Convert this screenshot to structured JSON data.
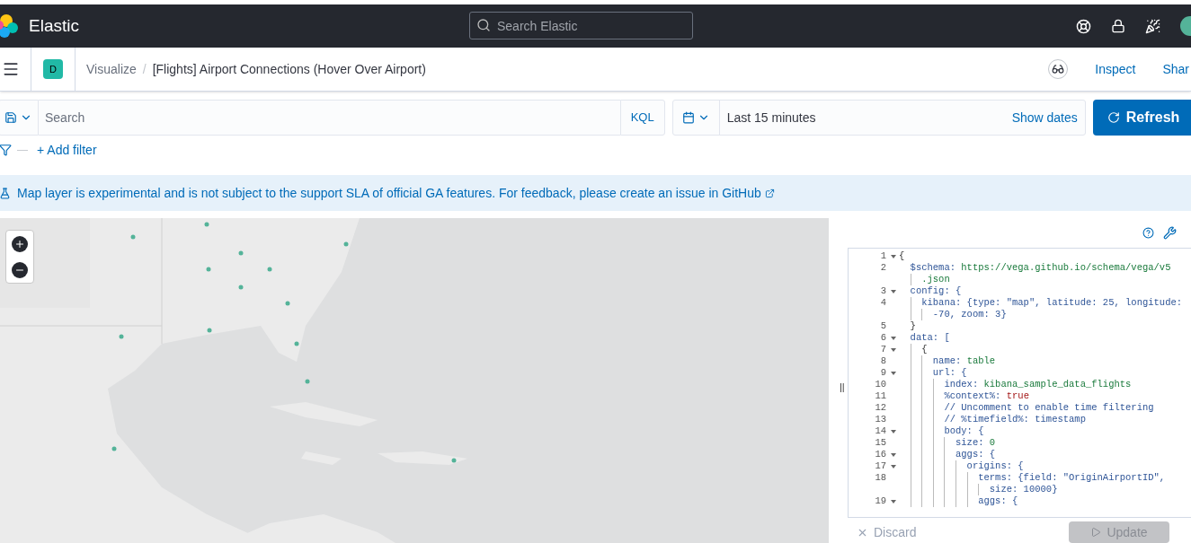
{
  "header": {
    "brand": "Elastic",
    "search_placeholder": "Search Elastic"
  },
  "breadcrumbs": {
    "space_badge": "D",
    "items": [
      {
        "label": "Visualize",
        "link": true
      },
      {
        "label": "[Flights] Airport Connections (Hover Over Airport)",
        "link": false
      }
    ],
    "separator": "/",
    "actions": [
      "Inspect",
      "Shar"
    ]
  },
  "query_bar": {
    "placeholder": "Search",
    "language": "KQL",
    "time_range": "Last 15 minutes",
    "show_dates": "Show dates",
    "refresh": "Refresh"
  },
  "filter_bar": {
    "separator": "—",
    "add_filter": "+ Add filter"
  },
  "callout": {
    "text": "Map layer is experimental and is not subject to the support SLA of official GA features. For feedback, please create an issue in GitHub"
  },
  "editor": {
    "handle": "||",
    "lines": [
      {
        "number": "1",
        "fold": true,
        "segments": [
          {
            "text": "{",
            "kind": "plain"
          }
        ]
      },
      {
        "number": "2",
        "fold": false,
        "segments": [
          {
            "text": "  $schema: ",
            "kind": "key"
          },
          {
            "text": "https://vega.github.io/schema/vega/v5",
            "kind": "str"
          }
        ],
        "continuation": [
          {
            "text": "    .json",
            "kind": "str"
          }
        ]
      },
      {
        "number": "3",
        "fold": true,
        "segments": [
          {
            "text": "  config: {",
            "kind": "key"
          }
        ]
      },
      {
        "number": "4",
        "fold": false,
        "segments": [
          {
            "text": "    kibana: {type: \"map\", latitude: 25, longitude:",
            "kind": "key"
          }
        ],
        "continuation": [
          {
            "text": "      -70, zoom: 3}",
            "kind": "key"
          }
        ]
      },
      {
        "number": "5",
        "fold": false,
        "segments": [
          {
            "text": "  }",
            "kind": "plain"
          }
        ]
      },
      {
        "number": "6",
        "fold": true,
        "segments": [
          {
            "text": "  data: [",
            "kind": "key"
          }
        ]
      },
      {
        "number": "7",
        "fold": true,
        "segments": [
          {
            "text": "    {",
            "kind": "plain"
          }
        ]
      },
      {
        "number": "8",
        "fold": false,
        "segments": [
          {
            "text": "      name: ",
            "kind": "key"
          },
          {
            "text": "table",
            "kind": "str"
          }
        ]
      },
      {
        "number": "9",
        "fold": true,
        "segments": [
          {
            "text": "      url: {",
            "kind": "key"
          }
        ]
      },
      {
        "number": "10",
        "fold": false,
        "segments": [
          {
            "text": "        index: ",
            "kind": "key"
          },
          {
            "text": "kibana_sample_data_flights",
            "kind": "str"
          }
        ]
      },
      {
        "number": "11",
        "fold": false,
        "segments": [
          {
            "text": "        %context%: ",
            "kind": "key"
          },
          {
            "text": "true",
            "kind": "keyword"
          }
        ]
      },
      {
        "number": "12",
        "fold": false,
        "segments": [
          {
            "text": "        // Uncomment to enable time filtering",
            "kind": "key"
          }
        ]
      },
      {
        "number": "13",
        "fold": false,
        "segments": [
          {
            "text": "        // %timefield%: timestamp",
            "kind": "key"
          }
        ]
      },
      {
        "number": "14",
        "fold": true,
        "segments": [
          {
            "text": "        body: {",
            "kind": "key"
          }
        ]
      },
      {
        "number": "15",
        "fold": false,
        "segments": [
          {
            "text": "          size: ",
            "kind": "key"
          },
          {
            "text": "0",
            "kind": "str"
          }
        ]
      },
      {
        "number": "16",
        "fold": true,
        "segments": [
          {
            "text": "          aggs: {",
            "kind": "key"
          }
        ]
      },
      {
        "number": "17",
        "fold": true,
        "segments": [
          {
            "text": "            origins: {",
            "kind": "key"
          }
        ]
      },
      {
        "number": "18",
        "fold": false,
        "segments": [
          {
            "text": "              terms: {field: \"OriginAirportID\",",
            "kind": "key"
          }
        ],
        "continuation": [
          {
            "text": "                size: 10000}",
            "kind": "key"
          }
        ]
      },
      {
        "number": "19",
        "fold": true,
        "segments": [
          {
            "text": "              aggs: {",
            "kind": "key"
          }
        ]
      }
    ],
    "discard": "Discard",
    "update": "Update",
    "update_disabled": true
  }
}
